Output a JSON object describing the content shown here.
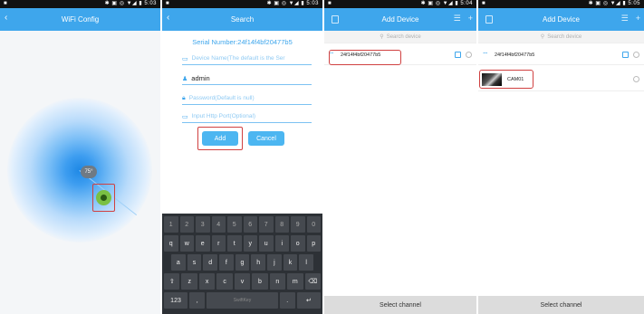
{
  "screen1": {
    "status_time": "5:03",
    "title": "WiFi Config",
    "back_icon": "chevron-left-icon",
    "degree": "75°"
  },
  "screen2": {
    "status_time": "5:03",
    "title": "Search",
    "back_icon": "chevron-left-icon",
    "serial": "Serial Number:24f14f4bf20477b5",
    "device_name_placeholder": "Device Name(The default is the Ser",
    "username_value": "admin",
    "password_placeholder": "Password(Default is null)",
    "http_port_placeholder": "Input Http Port(Optional)",
    "add_label": "Add",
    "cancel_label": "Cancel",
    "keyboard": {
      "row1": [
        "1",
        "2",
        "3",
        "4",
        "5",
        "6",
        "7",
        "8",
        "9",
        "0"
      ],
      "row2": [
        "q",
        "w",
        "e",
        "r",
        "t",
        "y",
        "u",
        "i",
        "o",
        "p"
      ],
      "row3": [
        "a",
        "s",
        "d",
        "f",
        "g",
        "h",
        "j",
        "k",
        "l"
      ],
      "row4": [
        "⇧",
        "z",
        "x",
        "c",
        "v",
        "b",
        "n",
        "m",
        "⌫"
      ],
      "row5_left": "123",
      "row5_space": "SwiftKey",
      "row5_right": "↵"
    }
  },
  "screen3": {
    "status_time": "5:04",
    "title": "Add Device",
    "search_placeholder": "Search device",
    "device": "24f14f4bf20477b5",
    "bottom": "Select channel"
  },
  "screen4": {
    "status_time": "5:05",
    "title": "Add Device",
    "search_placeholder": "Search device",
    "device": "24f14f4bf20477b5",
    "channel": "CAM01",
    "bottom": "Select channel"
  },
  "colors": {
    "accent": "#3ea6ec",
    "highlight": "#d04040",
    "keyboard_bg": "#2d3136"
  }
}
